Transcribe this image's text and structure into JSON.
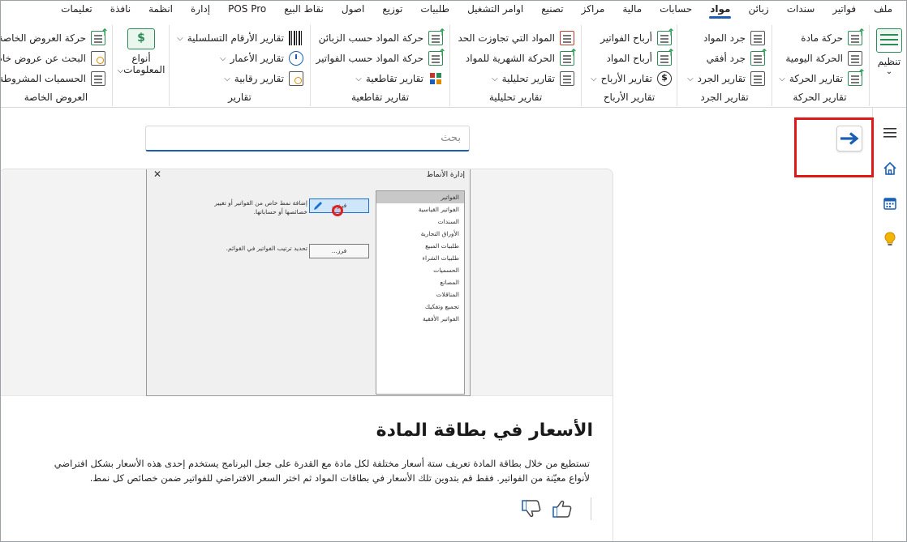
{
  "menu": {
    "items": [
      "ملف",
      "فواتير",
      "سندات",
      "زبائن",
      "مواد",
      "حسابات",
      "مالية",
      "مراكز",
      "تصنيع",
      "اوامر التشغيل",
      "طلبيات",
      "توزيع",
      "اصول",
      "نقاط البيع",
      "POS Pro",
      "إدارة",
      "انظمة",
      "نافذة",
      "تعليمات"
    ],
    "active_index": 4
  },
  "ribbon": {
    "organize": {
      "label": "تنظيم"
    },
    "movement": {
      "label": "تقارير الحركة",
      "items": [
        "حركة مادة",
        "الحركة اليومية",
        "تقارير الحركة"
      ]
    },
    "inventory": {
      "label": "تقارير الجرد",
      "items": [
        "جرد المواد",
        "جرد أفقي",
        "تقارير الجرد"
      ]
    },
    "profits": {
      "label": "تقارير الأرباح",
      "items": [
        "أرباح الفواتير",
        "أرباح المواد",
        "تقارير الأرباح"
      ]
    },
    "analytical": {
      "label": "تقارير تحليلية",
      "items": [
        "المواد التي تجاوزت الحد",
        "الحركة الشهرية للمواد",
        "تقارير تحليلية"
      ]
    },
    "cross": {
      "label": "تقارير تقاطعية",
      "items": [
        "حركة المواد حسب الزبائن",
        "حركة المواد حسب الفواتير",
        "تقارير تقاطعية"
      ]
    },
    "reports": {
      "label": "تقارير",
      "items": [
        "تقارير الأرقام التسلسلية",
        "تقارير الأعمار",
        "تقارير رقابية"
      ]
    },
    "price_types": {
      "label_line1": "أنواع",
      "label_line2": "المعلومات"
    },
    "offers": {
      "label": "العروض الخاصة",
      "items": [
        "حركة العروض الخاصة",
        "البحث عن عروض خاصة",
        "الحسميات المشروطة"
      ]
    }
  },
  "search": {
    "placeholder": "بحث",
    "value": ""
  },
  "card": {
    "title": "الأسعار في بطاقة المادة",
    "body": "تستطيع من خلال بطاقة المادة تعريف ستة أسعار مختلفة لكل مادة مع القدرة على جعل البرنامج يستخدم إحدى هذه الأسعار بشكل افتراضي لأنواع معيّنة من الفواتير. فقط قم بتدوين تلك الأسعار في بطاقات المواد ثم اختر السعر الافتراضي للفواتير ضمن خصائص كل نمط.",
    "dialog": {
      "title": "إدارة الأنماط",
      "close": "✕",
      "list": [
        "الفواتير",
        "الفواتير القياسية",
        "السندات",
        "الأوراق التجارية",
        "طلبيات المبيع",
        "طلبيات الشراء",
        "الحسميات",
        "المصانع",
        "المناقلات",
        "تجميع وتفكيك",
        "الفواتير الأفقية"
      ],
      "add_text": "إضافة نمط خاص من الفواتير أو تغيير خصائصها أو حساباتها.",
      "add_button": "فرز...",
      "order_text": "تحديد ترتيب الفواتير في القوائم.",
      "order_button": "فرز..."
    }
  },
  "colors": {
    "accent": "#1a5fb4",
    "highlight": "#e01818"
  }
}
